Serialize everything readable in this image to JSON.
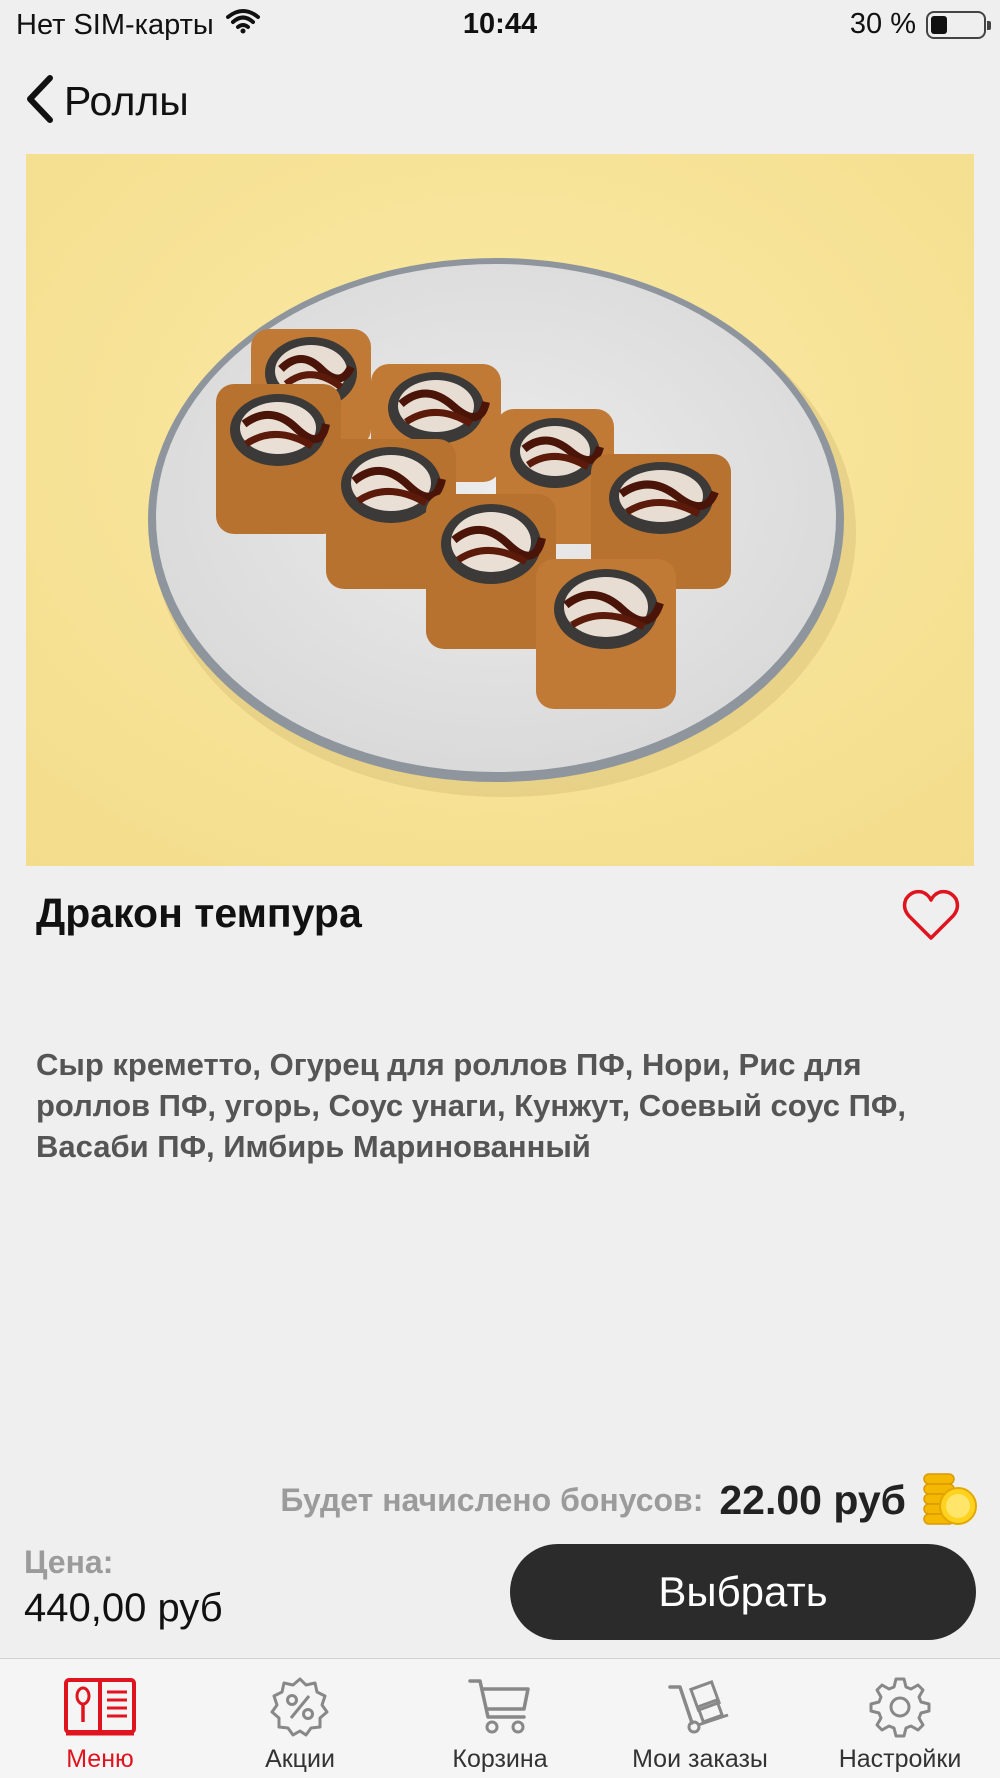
{
  "status_bar": {
    "carrier": "Нет SIM-карты",
    "time": "10:44",
    "battery_text": "30 %",
    "battery_level": 0.3
  },
  "nav": {
    "back_title": "Роллы"
  },
  "product": {
    "title": "Дракон темпура",
    "description": "Сыр креметто, Огурец для роллов ПФ, Нори, Рис для роллов ПФ, угорь, Соус унаги, Кунжут, Соевый соус ПФ, Васаби ПФ, Имбирь Маринованный",
    "image_icon": "sushi-rolls-photo"
  },
  "bonus": {
    "label": "Будет начислено бонусов:",
    "value": "22.00 руб",
    "icon": "coins-icon"
  },
  "price": {
    "label": "Цена:",
    "value": "440,00 руб"
  },
  "select_button_label": "Выбрать",
  "colors": {
    "accent": "#e0141e",
    "button_bg": "#2b2b2b",
    "image_bg": "#f7e49a",
    "coin": "#f5b800"
  },
  "tabs": [
    {
      "label": "Меню",
      "icon": "menu-book-icon",
      "active": true
    },
    {
      "label": "Акции",
      "icon": "percent-badge-icon",
      "active": false
    },
    {
      "label": "Корзина",
      "icon": "cart-icon",
      "active": false
    },
    {
      "label": "Мои заказы",
      "icon": "hand-truck-icon",
      "active": false
    },
    {
      "label": "Настройки",
      "icon": "gear-icon",
      "active": false
    }
  ]
}
